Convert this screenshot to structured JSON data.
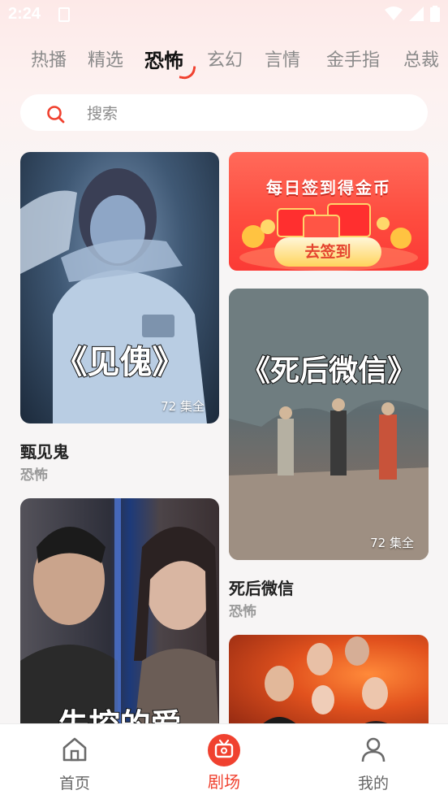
{
  "status_bar": {
    "time": "2:24",
    "icons": [
      "notification-icon",
      "wifi-icon",
      "signal-icon",
      "battery-icon"
    ]
  },
  "tabs": [
    {
      "label": "热播",
      "active": false
    },
    {
      "label": "精选",
      "active": false
    },
    {
      "label": "恐怖",
      "active": true
    },
    {
      "label": "玄幻",
      "active": false
    },
    {
      "label": "言情",
      "active": false
    },
    {
      "label": "金手指",
      "active": false
    },
    {
      "label": "总裁",
      "active": false
    }
  ],
  "search": {
    "placeholder": "搜索",
    "icon": "search-icon"
  },
  "banner": {
    "title": "每日签到得金币",
    "button_label": "去签到"
  },
  "dramas": [
    {
      "overlay_title": "《见傀》",
      "episodes": "72 集全",
      "name": "甄见鬼",
      "genre": "恐怖"
    },
    {
      "overlay_title": "《死后微信》",
      "episodes": "72 集全",
      "name": "死后微信",
      "genre": "恐怖"
    },
    {
      "overlay_title": "失控的爱",
      "episodes": "",
      "name": "",
      "genre": ""
    },
    {
      "overlay_title": "",
      "episodes": "",
      "name": "",
      "genre": ""
    }
  ],
  "bottom_nav": [
    {
      "label": "首页",
      "icon": "home-icon",
      "active": false
    },
    {
      "label": "剧场",
      "icon": "theater-icon",
      "active": true
    },
    {
      "label": "我的",
      "icon": "profile-icon",
      "active": false
    }
  ],
  "colors": {
    "accent": "#f0412f",
    "inactive_tab": "#8a8a8a",
    "nav_inactive": "#666666"
  }
}
